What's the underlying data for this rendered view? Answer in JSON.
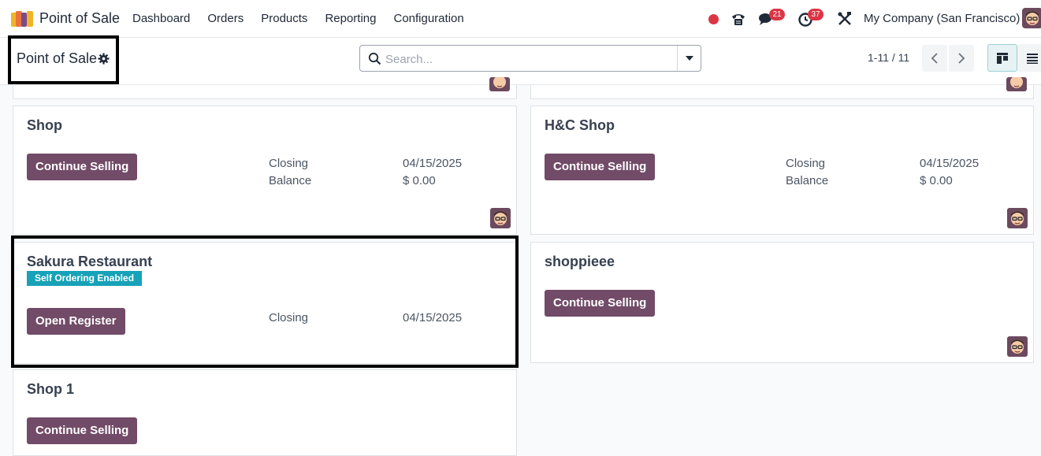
{
  "navbar": {
    "app_name": "Point of Sale",
    "menu": [
      "Dashboard",
      "Orders",
      "Products",
      "Reporting",
      "Configuration"
    ],
    "chat_badge": "21",
    "activity_badge": "37",
    "company": "My Company (San Francisco)"
  },
  "control": {
    "breadcrumb": "Point of Sale",
    "search_placeholder": "Search...",
    "pager": "1-11 / 11"
  },
  "cards": {
    "shop": {
      "title": "Shop",
      "button": "Continue Selling",
      "closing_label": "Closing",
      "closing_value": "04/15/2025",
      "balance_label": "Balance",
      "balance_value": "$ 0.00"
    },
    "hc_shop": {
      "title": "H&C Shop",
      "button": "Continue Selling",
      "closing_label": "Closing",
      "closing_value": "04/15/2025",
      "balance_label": "Balance",
      "balance_value": "$ 0.00"
    },
    "sakura": {
      "title": "Sakura Restaurant",
      "ribbon": "Self Ordering Enabled",
      "button": "Open Register",
      "closing_label": "Closing",
      "closing_value": "04/15/2025"
    },
    "shoppieee": {
      "title": "shoppieee",
      "button": "Continue Selling"
    },
    "shop1": {
      "title": "Shop 1",
      "button": "Continue Selling"
    }
  },
  "colors": {
    "primary": "#714b67",
    "ribbon": "#17a2b8",
    "badge": "#dc3545"
  }
}
